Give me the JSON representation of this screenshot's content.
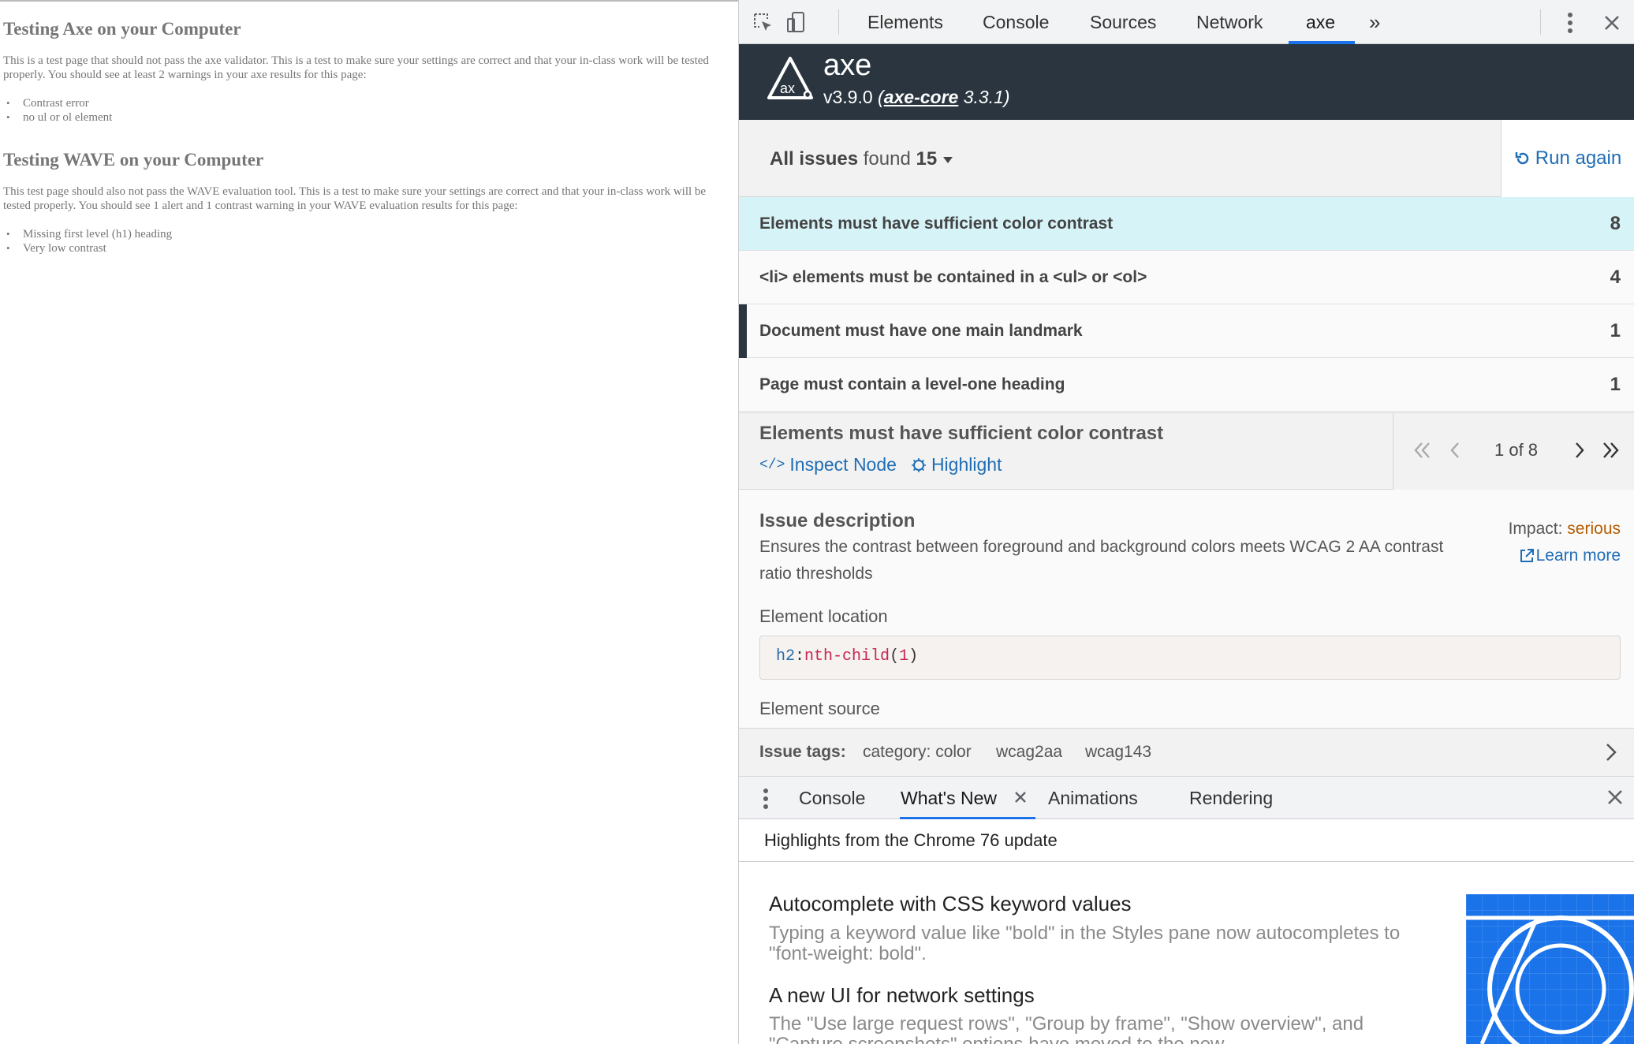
{
  "page": {
    "heading_axe": "Testing Axe on your Computer",
    "para_axe": "This is a test page that should not pass the axe validator. This is a test to make sure your settings are correct and that your in-class work will be tested properly. You should see at least 2 warnings in your axe results for this page:",
    "list_axe": [
      "Contrast error",
      "no ul or ol element"
    ],
    "heading_wave": "Testing WAVE on your Computer",
    "para_wave": "This test page should also not pass the WAVE evaluation tool. This is a test to make sure your settings are correct and that your in-class work will be tested properly. You should see 1 alert and 1 contrast warning in your WAVE evaluation results for this page:",
    "list_wave": [
      "Missing first level (h1) heading",
      "Very low contrast"
    ]
  },
  "devtools": {
    "tabs": [
      "Elements",
      "Console",
      "Sources",
      "Network",
      "axe"
    ],
    "more_tabs": "»",
    "active_tab": "axe",
    "icons": [
      "inspect-element-icon",
      "device-toolbar-icon",
      "kebab-menu-icon",
      "close-icon"
    ]
  },
  "axe": {
    "title": "axe",
    "version": "v3.9.0",
    "core_link": "axe-core",
    "core_version": "3.3.1",
    "issues_label": "All issues",
    "issues_found": "found",
    "issues_count": "15",
    "run_again": "Run again",
    "rules": [
      {
        "name": "Elements must have sufficient color contrast",
        "count": "8"
      },
      {
        "name": "<li> elements must be contained in a <ul> or <ol>",
        "count": "4"
      },
      {
        "name": "Document must have one main landmark",
        "count": "1"
      },
      {
        "name": "Page must contain a level-one heading",
        "count": "1"
      }
    ],
    "detail": {
      "title": "Elements must have sufficient color contrast",
      "inspect_node": "Inspect Node",
      "highlight": "Highlight",
      "pager": "1 of 8",
      "issue_description_title": "Issue description",
      "issue_description": "Ensures the contrast between foreground and background colors meets WCAG 2 AA contrast ratio thresholds",
      "impact_label": "Impact:",
      "impact_value": "serious",
      "learn_more": "Learn more",
      "element_location_title": "Element location",
      "selector_tag": "h2",
      "selector_colon": ":",
      "selector_pseudo": "nth-child",
      "selector_open": "(",
      "selector_num": "1",
      "selector_close": ")",
      "element_source_title": "Element source",
      "tags_label": "Issue tags:",
      "tags": [
        "category: color",
        "wcag2aa",
        "wcag143"
      ]
    }
  },
  "drawer": {
    "tabs": [
      "Console",
      "What's New",
      "Animations",
      "Rendering"
    ],
    "active_tab": "What's New",
    "header": "Highlights from the Chrome 76 update",
    "items": [
      {
        "title": "Autocomplete with CSS keyword values",
        "desc": "Typing a keyword value like \"bold\" in the Styles pane now autocompletes to \"font-weight: bold\"."
      },
      {
        "title": "A new UI for network settings",
        "desc": "The \"Use large request rows\", \"Group by frame\", \"Show overview\", and \"Capture screenshots\" options have moved to the new"
      }
    ]
  },
  "colors": {
    "axe_header": "#2a353f",
    "selected_row": "#d6f3f7",
    "link_blue": "#1f6db5",
    "impact_serious": "#b35c00",
    "tab_underline": "#1a73e8"
  }
}
